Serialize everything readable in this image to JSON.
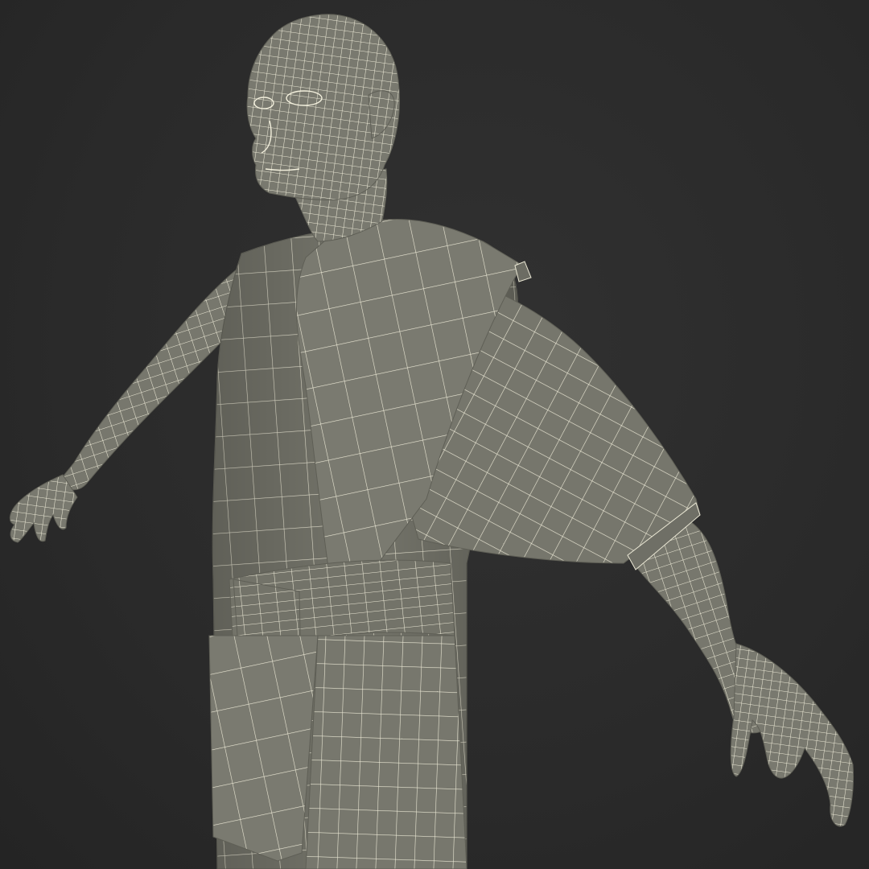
{
  "scene": {
    "background_color": "#2b2b2b",
    "surface_color": "#77776d",
    "wire_color": "#e9e6d2",
    "shadow_color": "#5e5e55",
    "subject": "wireframe-robed-figure"
  }
}
